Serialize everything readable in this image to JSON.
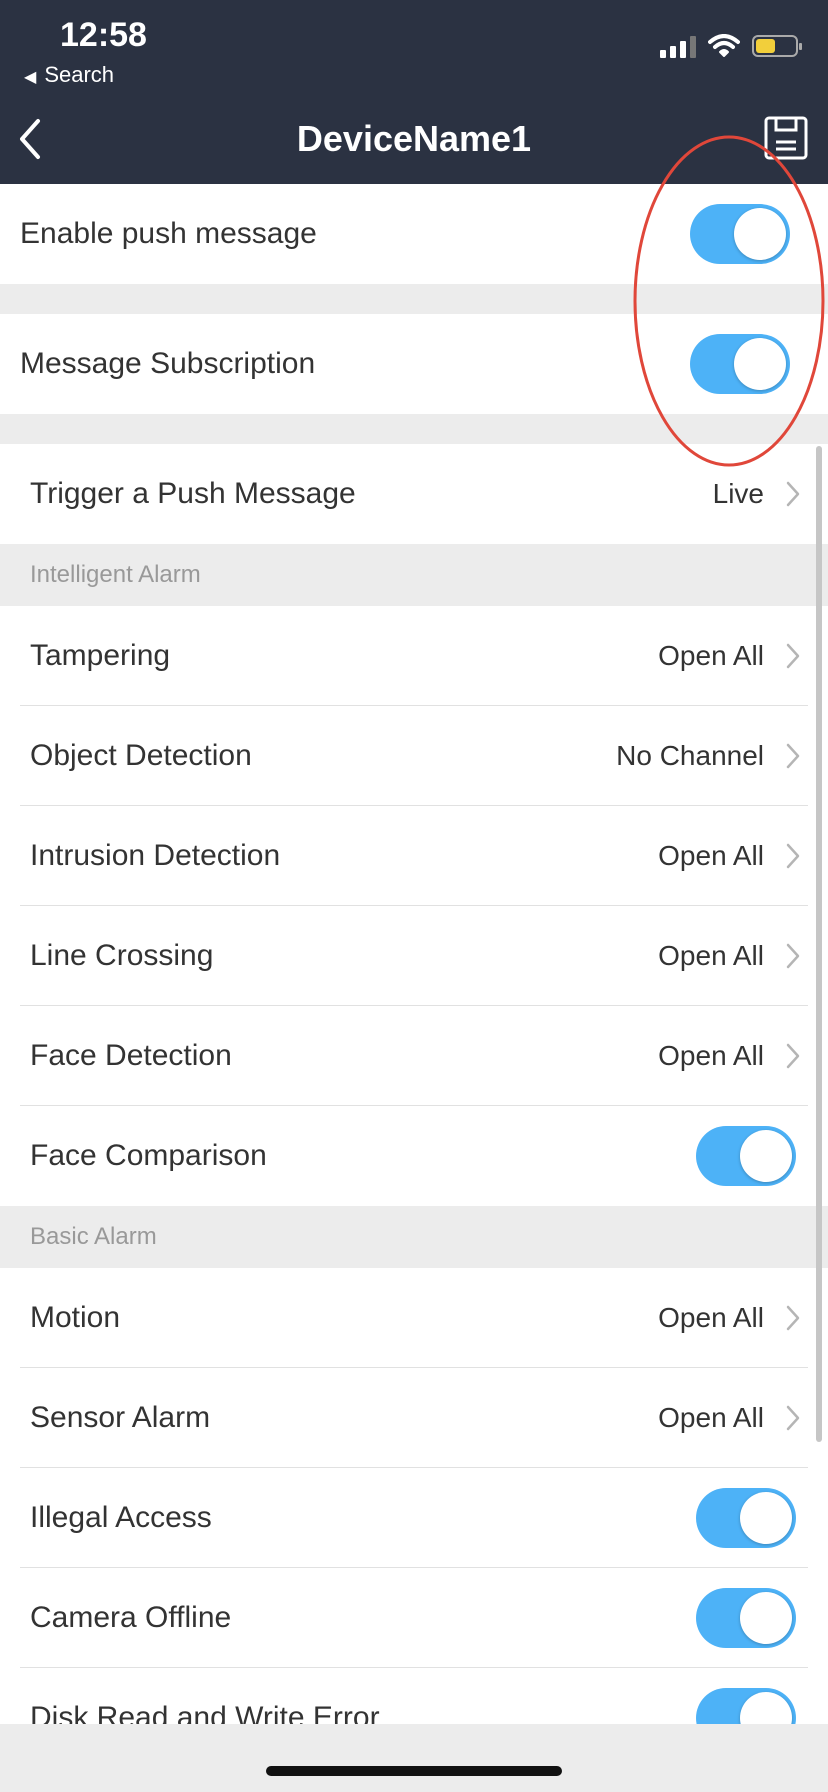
{
  "status_bar": {
    "time": "12:58",
    "back_app": "Search"
  },
  "nav": {
    "title": "DeviceName1"
  },
  "top_toggles": [
    {
      "label": "Enable push message",
      "on": true
    },
    {
      "label": "Message Subscription",
      "on": true
    }
  ],
  "trigger": {
    "label": "Trigger a Push Message",
    "value": "Live"
  },
  "intelligent_alarm": {
    "header": "Intelligent Alarm",
    "items": [
      {
        "label": "Tampering",
        "value": "Open All"
      },
      {
        "label": "Object Detection",
        "value": "No Channel"
      },
      {
        "label": "Intrusion Detection",
        "value": "Open All"
      },
      {
        "label": "Line Crossing",
        "value": "Open All"
      },
      {
        "label": "Face Detection",
        "value": "Open All"
      },
      {
        "label": "Face Comparison",
        "toggle": true
      }
    ]
  },
  "basic_alarm": {
    "header": "Basic Alarm",
    "items": [
      {
        "label": "Motion",
        "value": "Open All"
      },
      {
        "label": "Sensor Alarm",
        "value": "Open All"
      },
      {
        "label": "Illegal Access",
        "toggle": true
      },
      {
        "label": "Camera Offline",
        "toggle": true
      },
      {
        "label": "Disk Read and Write Error",
        "toggle": true
      }
    ]
  },
  "colors": {
    "nav_background": "#2b3242",
    "toggle_on": "#4db2f7",
    "annotation_ellipse": "#e0473a"
  }
}
